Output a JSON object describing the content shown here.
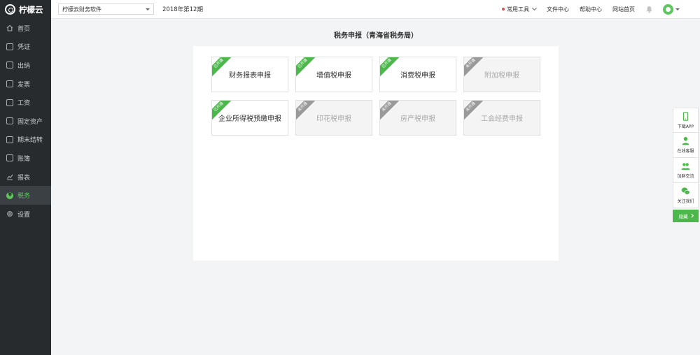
{
  "app": {
    "name": "柠檬云"
  },
  "sidebar": {
    "items": [
      {
        "label": "首页",
        "icon": "home-icon"
      },
      {
        "label": "凭证",
        "icon": "voucher-icon"
      },
      {
        "label": "出纳",
        "icon": "cashier-icon"
      },
      {
        "label": "发票",
        "icon": "invoice-icon"
      },
      {
        "label": "工资",
        "icon": "salary-icon"
      },
      {
        "label": "固定资产",
        "icon": "asset-icon"
      },
      {
        "label": "期末结转",
        "icon": "period-end-icon"
      },
      {
        "label": "账簿",
        "icon": "ledger-icon"
      },
      {
        "label": "报表",
        "icon": "report-icon"
      },
      {
        "label": "税务",
        "icon": "tax-icon"
      },
      {
        "label": "设置",
        "icon": "gear-icon"
      }
    ],
    "active_index": 9
  },
  "topbar": {
    "company": "柠檬云财务软件",
    "period": "2018年第12期",
    "tools": "常用工具",
    "files": "文件中心",
    "help": "帮助中心",
    "home": "网站首页"
  },
  "main": {
    "title": "税务申报（青海省税务局）",
    "tiles": [
      {
        "label": "财务报表申报",
        "badge": "已开通",
        "active": true
      },
      {
        "label": "增值税申报",
        "badge": "已开通",
        "active": true
      },
      {
        "label": "消费税申报",
        "badge": "已开通",
        "active": true
      },
      {
        "label": "附加税申报",
        "badge": "未开通",
        "active": false
      },
      {
        "label": "企业所得税预缴申报",
        "badge": "已开通",
        "active": true
      },
      {
        "label": "印花税申报",
        "badge": "未开通",
        "active": false
      },
      {
        "label": "房产税申报",
        "badge": "未开通",
        "active": false
      },
      {
        "label": "工会经费申报",
        "badge": "未开通",
        "active": false
      }
    ]
  },
  "float_panel": {
    "download": "下载APP",
    "service": "在线客服",
    "group": "加群交流",
    "follow": "关注我们",
    "hide": "隐藏"
  },
  "colors": {
    "accent": "#4cb84c",
    "sidebar_bg": "#272b2e",
    "inactive_ribbon": "#9a9a9a"
  }
}
